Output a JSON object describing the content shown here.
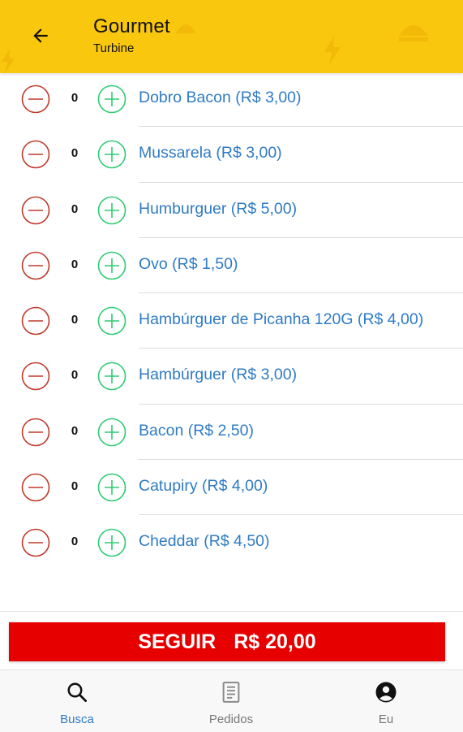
{
  "header": {
    "title": "Gourmet",
    "subtitle": "Turbine",
    "color": "#f9c70d"
  },
  "items": [
    {
      "quantity": "0",
      "label": "Dobro Bacon (R$ 3,00)"
    },
    {
      "quantity": "0",
      "label": "Mussarela (R$ 3,00)"
    },
    {
      "quantity": "0",
      "label": "Humburguer (R$ 5,00)"
    },
    {
      "quantity": "0",
      "label": "Ovo (R$ 1,50)"
    },
    {
      "quantity": "0",
      "label": "Hambúrguer de Picanha 120G (R$ 4,00)"
    },
    {
      "quantity": "0",
      "label": "Hambúrguer (R$ 3,00)"
    },
    {
      "quantity": "0",
      "label": "Bacon (R$ 2,50)"
    },
    {
      "quantity": "0",
      "label": "Catupiry (R$ 4,00)"
    },
    {
      "quantity": "0",
      "label": "Cheddar (R$ 4,50)"
    }
  ],
  "continue": {
    "label": "SEGUIR",
    "total": "R$ 20,00",
    "color": "#e60000"
  },
  "nav": {
    "search_label": "Busca",
    "orders_label": "Pedidos",
    "me_label": "Eu",
    "active_color": "#2f7bc4"
  },
  "icons": {
    "back": "arrow-left-icon",
    "minus": "minus-circle-icon",
    "plus": "plus-circle-icon",
    "search": "search-icon",
    "orders": "receipt-icon",
    "me": "account-circle-icon"
  },
  "colors": {
    "minus": "#c0392b",
    "plus": "#2ecc71",
    "link": "#2f7bc4"
  }
}
